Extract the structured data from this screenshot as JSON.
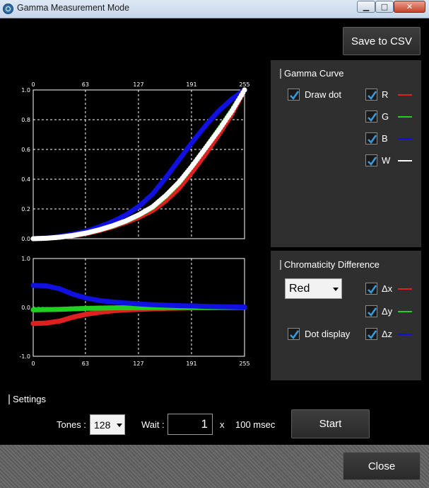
{
  "window": {
    "title": "Gamma Measurement Mode",
    "minimize_glyph": "▁",
    "maximize_glyph": "□",
    "close_glyph": "✕"
  },
  "toolbar": {
    "save_label": "Save to CSV"
  },
  "gamma_panel": {
    "title": "Gamma Curve",
    "draw_dot": {
      "label": "Draw dot",
      "checked": true
    },
    "channels": [
      {
        "label": "R",
        "checked": true,
        "color": "#e02020"
      },
      {
        "label": "G",
        "checked": true,
        "color": "#20d020"
      },
      {
        "label": "B",
        "checked": true,
        "color": "#1010e0"
      },
      {
        "label": "W",
        "checked": true,
        "color": "#ffffff"
      }
    ]
  },
  "chroma_panel": {
    "title": "Chromaticity Difference",
    "color_select": {
      "value": "Red"
    },
    "dot_display": {
      "label": "Dot display",
      "checked": true
    },
    "channels": [
      {
        "label": "Δx",
        "checked": true,
        "color": "#e02020"
      },
      {
        "label": "Δy",
        "checked": true,
        "color": "#20d020"
      },
      {
        "label": "Δz",
        "checked": true,
        "color": "#1010e0"
      }
    ]
  },
  "settings": {
    "title": "Settings",
    "tones_label": "Tones :",
    "tones_value": "128",
    "wait_label": "Wait :",
    "wait_value": "1",
    "multiplier_label": "x",
    "unit_label": "100 msec",
    "start_label": "Start"
  },
  "footer": {
    "close_label": "Close"
  },
  "chart_data": [
    {
      "type": "scatter",
      "title": "",
      "xlabel": "",
      "ylabel": "",
      "xlim": [
        0,
        255
      ],
      "ylim": [
        0,
        1
      ],
      "x_ticks": [
        "0",
        "63",
        "127",
        "191",
        "255"
      ],
      "y_ticks": [
        "1.0",
        "0.8",
        "0.6",
        "0.4",
        "0.2",
        "0.0"
      ],
      "grid": true,
      "x_ticks_position": "top",
      "x": [
        0,
        16,
        32,
        48,
        64,
        80,
        96,
        112,
        128,
        144,
        160,
        176,
        192,
        208,
        224,
        240,
        255
      ],
      "series": [
        {
          "name": "R",
          "color": "#e02020",
          "values": [
            0.0,
            0.003,
            0.01,
            0.02,
            0.035,
            0.055,
            0.08,
            0.11,
            0.145,
            0.19,
            0.255,
            0.34,
            0.45,
            0.57,
            0.7,
            0.84,
            1.0
          ]
        },
        {
          "name": "G",
          "color": "#20d020",
          "values": [
            0.0,
            0.003,
            0.01,
            0.022,
            0.038,
            0.06,
            0.085,
            0.118,
            0.16,
            0.21,
            0.285,
            0.375,
            0.49,
            0.61,
            0.735,
            0.865,
            1.0
          ]
        },
        {
          "name": "B",
          "color": "#1010e0",
          "values": [
            0.0,
            0.004,
            0.015,
            0.03,
            0.05,
            0.08,
            0.115,
            0.16,
            0.22,
            0.3,
            0.41,
            0.53,
            0.65,
            0.76,
            0.86,
            0.94,
            1.0
          ]
        },
        {
          "name": "W",
          "color": "#ffffff",
          "values": [
            0.0,
            0.003,
            0.01,
            0.022,
            0.038,
            0.06,
            0.087,
            0.12,
            0.162,
            0.214,
            0.29,
            0.38,
            0.49,
            0.61,
            0.73,
            0.86,
            1.0
          ]
        }
      ]
    },
    {
      "type": "scatter",
      "title": "",
      "xlabel": "",
      "ylabel": "",
      "xlim": [
        0,
        255
      ],
      "ylim": [
        -1,
        1
      ],
      "x_ticks": [
        "0",
        "63",
        "127",
        "191",
        "255"
      ],
      "y_ticks": [
        "1.0",
        "0.0",
        "-1.0"
      ],
      "grid": true,
      "x_ticks_position": "bottom",
      "x": [
        0,
        16,
        32,
        48,
        64,
        80,
        96,
        112,
        128,
        144,
        160,
        176,
        192,
        208,
        224,
        240,
        255
      ],
      "series": [
        {
          "name": "Δx",
          "color": "#e02020",
          "values": [
            -0.33,
            -0.32,
            -0.28,
            -0.2,
            -0.14,
            -0.1,
            -0.07,
            -0.05,
            -0.04,
            -0.03,
            -0.02,
            -0.015,
            -0.01,
            -0.008,
            -0.005,
            -0.002,
            0.0
          ]
        },
        {
          "name": "Δy",
          "color": "#20d020",
          "values": [
            -0.05,
            -0.045,
            -0.04,
            -0.03,
            -0.02,
            -0.015,
            -0.01,
            -0.008,
            -0.005,
            -0.003,
            -0.002,
            -0.001,
            0.0,
            0.0,
            0.0,
            0.0,
            0.0
          ]
        },
        {
          "name": "Δz",
          "color": "#1010e0",
          "values": [
            0.45,
            0.44,
            0.38,
            0.27,
            0.19,
            0.14,
            0.11,
            0.09,
            0.07,
            0.055,
            0.045,
            0.035,
            0.03,
            0.02,
            0.015,
            0.01,
            0.005
          ]
        }
      ]
    }
  ]
}
